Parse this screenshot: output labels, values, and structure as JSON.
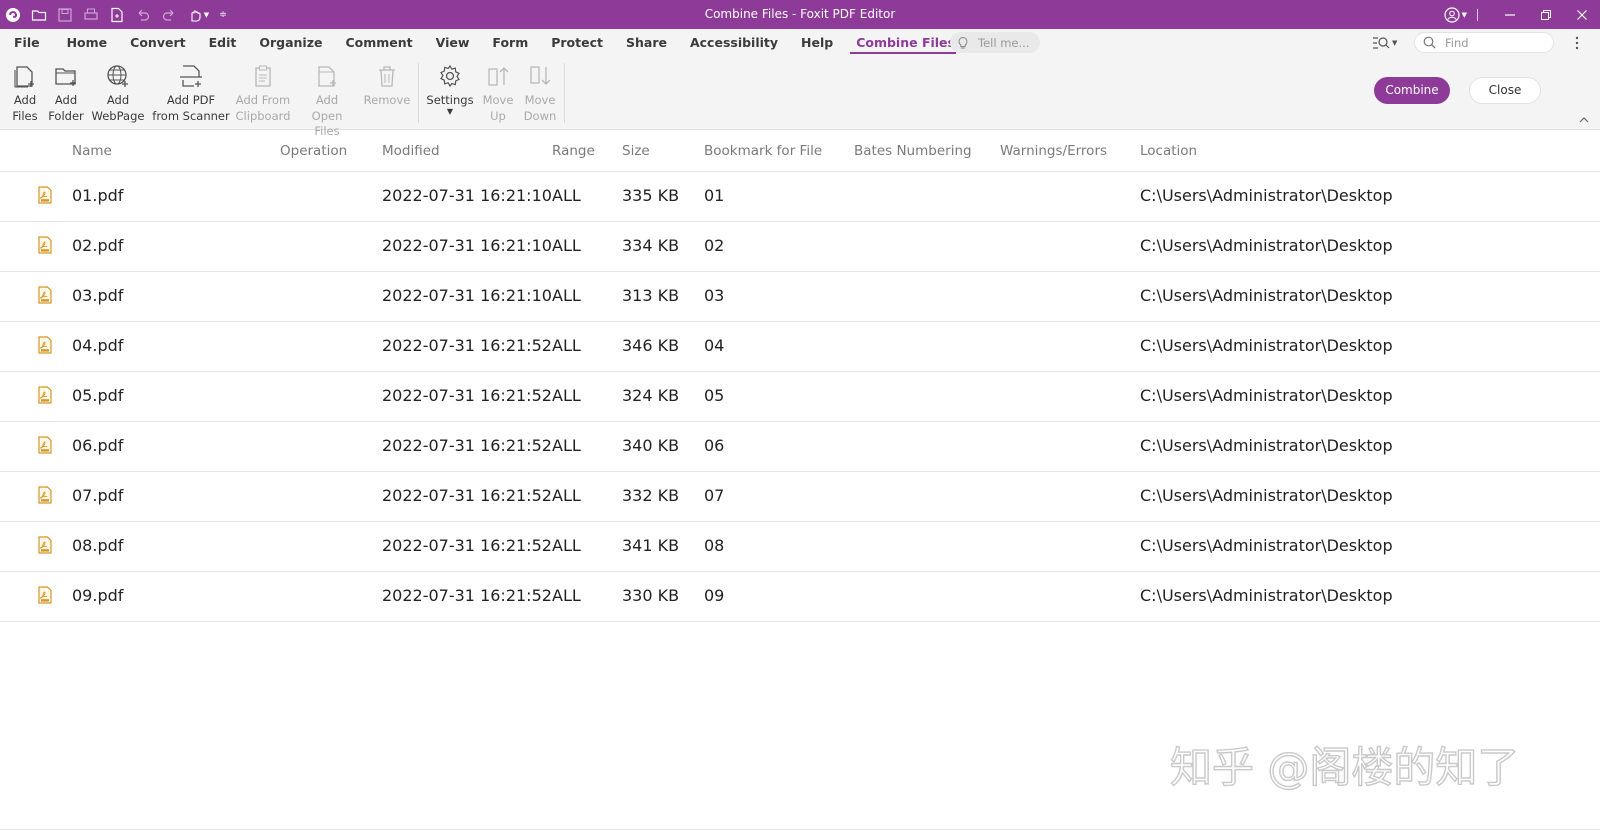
{
  "titlebar": {
    "title": "Combine Files - Foxit PDF Editor",
    "quick_access": [
      "foxit-logo-icon",
      "open-folder-icon",
      "save-icon",
      "print-icon",
      "new-pdf-icon",
      "undo-icon",
      "redo-icon",
      "hand-tool-icon",
      "customize-qa-icon"
    ],
    "window_controls": [
      "account-icon",
      "minimize-icon",
      "restore-icon",
      "close-icon"
    ]
  },
  "menu": {
    "tabs": [
      "File",
      "Home",
      "Convert",
      "Edit",
      "Organize",
      "Comment",
      "View",
      "Form",
      "Protect",
      "Share",
      "Accessibility",
      "Help",
      "Combine Files"
    ],
    "active_tab": "Combine Files",
    "tell_me_placeholder": "Tell me...",
    "find_placeholder": "Find"
  },
  "ribbon": {
    "add_files": [
      "Add",
      "Files"
    ],
    "add_folder": [
      "Add",
      "Folder"
    ],
    "add_webpage": [
      "Add",
      "WebPage"
    ],
    "add_scanner": [
      "Add PDF",
      "from Scanner"
    ],
    "add_clipboard": [
      "Add From",
      "Clipboard"
    ],
    "add_open_files": [
      "Add",
      "Open Files"
    ],
    "remove": [
      "Remove"
    ],
    "settings": [
      "Settings"
    ],
    "move_up": [
      "Move",
      "Up"
    ],
    "move_down": [
      "Move",
      "Down"
    ],
    "combine_label": "Combine",
    "close_label": "Close"
  },
  "table": {
    "headers": {
      "name": "Name",
      "operation": "Operation",
      "modified": "Modified",
      "range": "Range",
      "size": "Size",
      "bookmark": "Bookmark for File",
      "bates": "Bates Numbering",
      "warnings": "Warnings/Errors",
      "location": "Location"
    },
    "rows": [
      {
        "name": "01.pdf",
        "modified": "2022-07-31 16:21:10",
        "range": "ALL",
        "size": "335 KB",
        "bookmark": "01",
        "location": "C:\\Users\\Administrator\\Desktop"
      },
      {
        "name": "02.pdf",
        "modified": "2022-07-31 16:21:10",
        "range": "ALL",
        "size": "334 KB",
        "bookmark": "02",
        "location": "C:\\Users\\Administrator\\Desktop"
      },
      {
        "name": "03.pdf",
        "modified": "2022-07-31 16:21:10",
        "range": "ALL",
        "size": "313 KB",
        "bookmark": "03",
        "location": "C:\\Users\\Administrator\\Desktop"
      },
      {
        "name": "04.pdf",
        "modified": "2022-07-31 16:21:52",
        "range": "ALL",
        "size": "346 KB",
        "bookmark": "04",
        "location": "C:\\Users\\Administrator\\Desktop"
      },
      {
        "name": "05.pdf",
        "modified": "2022-07-31 16:21:52",
        "range": "ALL",
        "size": "324 KB",
        "bookmark": "05",
        "location": "C:\\Users\\Administrator\\Desktop"
      },
      {
        "name": "06.pdf",
        "modified": "2022-07-31 16:21:52",
        "range": "ALL",
        "size": "340 KB",
        "bookmark": "06",
        "location": "C:\\Users\\Administrator\\Desktop"
      },
      {
        "name": "07.pdf",
        "modified": "2022-07-31 16:21:52",
        "range": "ALL",
        "size": "332 KB",
        "bookmark": "07",
        "location": "C:\\Users\\Administrator\\Desktop"
      },
      {
        "name": "08.pdf",
        "modified": "2022-07-31 16:21:52",
        "range": "ALL",
        "size": "341 KB",
        "bookmark": "08",
        "location": "C:\\Users\\Administrator\\Desktop"
      },
      {
        "name": "09.pdf",
        "modified": "2022-07-31 16:21:52",
        "range": "ALL",
        "size": "330 KB",
        "bookmark": "09",
        "location": "C:\\Users\\Administrator\\Desktop"
      }
    ]
  },
  "watermark": {
    "text": "知乎 @阁楼的知了"
  },
  "colors": {
    "accent": "#8e3a99",
    "ribbon_bg": "#f4f4f4",
    "disabled_text": "#a9a9a9",
    "file_icon": "#d4962a"
  }
}
